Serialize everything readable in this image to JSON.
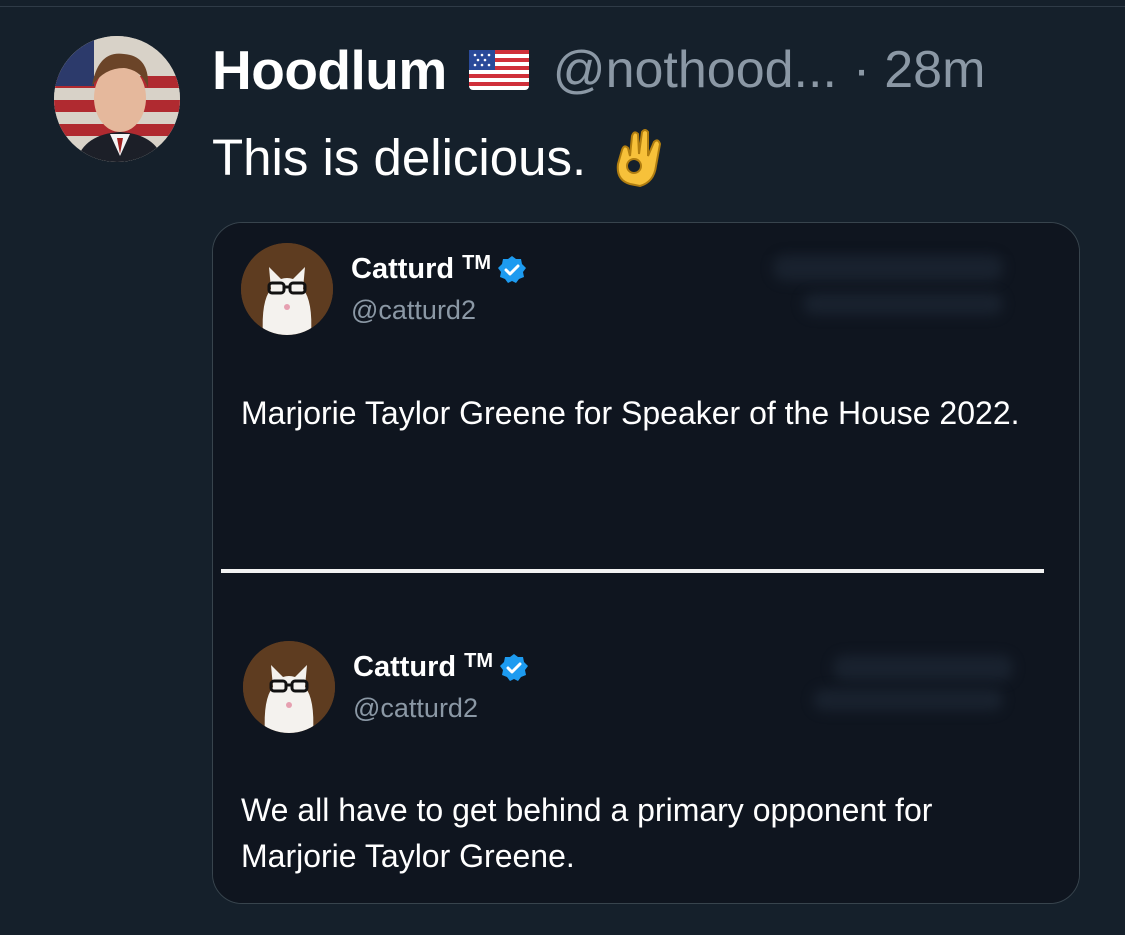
{
  "tweet": {
    "display_name": "Hoodlum",
    "flag_icon": "us-flag-icon",
    "handle": "@nothood...",
    "separator": "·",
    "time": "28m",
    "text": "This is delicious.",
    "emoji_icon": "ok-hand-icon"
  },
  "quoted_image": {
    "posts": [
      {
        "name": "Catturd",
        "tm": "TM",
        "verified": true,
        "handle": "@catturd2",
        "text": "Marjorie Taylor Greene for Speaker of the House 2022."
      },
      {
        "name": "Catturd",
        "tm": "TM",
        "verified": true,
        "handle": "@catturd2",
        "text": "We all have to get behind a primary opponent for Marjorie Taylor Greene."
      }
    ]
  },
  "colors": {
    "background": "#15202b",
    "secondary_text": "#8b98a5",
    "verified_blue": "#1d9bf0",
    "card_border": "#38444d"
  }
}
